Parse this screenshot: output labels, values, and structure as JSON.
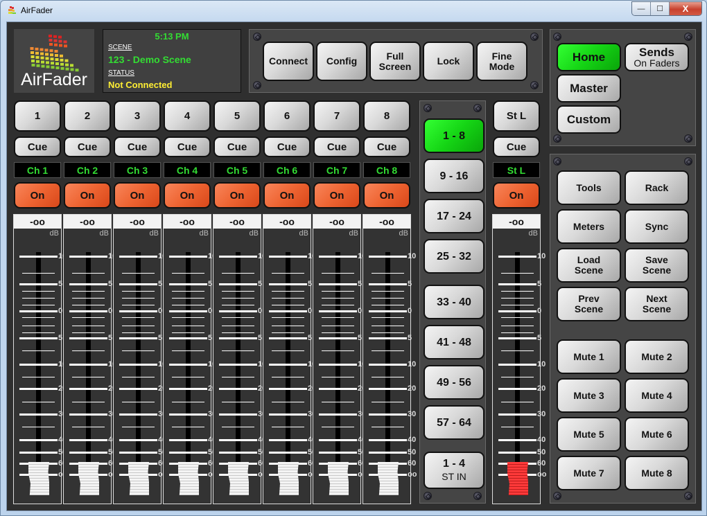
{
  "window": {
    "title": "AirFader",
    "controls": {
      "minimize": "—",
      "maximize": "☐",
      "close": "X"
    }
  },
  "logo": {
    "text": "AirFader"
  },
  "info": {
    "time": "5:13 PM",
    "scene_label": "SCENE",
    "scene_value": "123 - Demo Scene",
    "status_label": "STATUS",
    "status_value": "Not Connected",
    "scene_color": "#33dd33",
    "status_color": "#ffee33"
  },
  "toolbar": {
    "buttons": [
      {
        "label": "Connect"
      },
      {
        "label": "Config"
      },
      {
        "label": "Full Screen"
      },
      {
        "label": "Lock"
      },
      {
        "label": "Fine Mode"
      }
    ]
  },
  "mode_panel": {
    "home": "Home",
    "sends": "Sends",
    "sends_sub": "On Faders",
    "master": "Master",
    "custom": "Custom"
  },
  "channels": [
    {
      "number": "1",
      "cue": "Cue",
      "name": "Ch 1",
      "on": "On",
      "level": "-oo",
      "unit": "dB"
    },
    {
      "number": "2",
      "cue": "Cue",
      "name": "Ch 2",
      "on": "On",
      "level": "-oo",
      "unit": "dB"
    },
    {
      "number": "3",
      "cue": "Cue",
      "name": "Ch 3",
      "on": "On",
      "level": "-oo",
      "unit": "dB"
    },
    {
      "number": "4",
      "cue": "Cue",
      "name": "Ch 4",
      "on": "On",
      "level": "-oo",
      "unit": "dB"
    },
    {
      "number": "5",
      "cue": "Cue",
      "name": "Ch 5",
      "on": "On",
      "level": "-oo",
      "unit": "dB"
    },
    {
      "number": "6",
      "cue": "Cue",
      "name": "Ch 6",
      "on": "On",
      "level": "-oo",
      "unit": "dB"
    },
    {
      "number": "7",
      "cue": "Cue",
      "name": "Ch 7",
      "on": "On",
      "level": "-oo",
      "unit": "dB"
    },
    {
      "number": "8",
      "cue": "Cue",
      "name": "Ch 8",
      "on": "On",
      "level": "-oo",
      "unit": "dB"
    }
  ],
  "stereo": {
    "number": "St L",
    "cue": "Cue",
    "name": "St L",
    "on": "On",
    "level": "-oo",
    "unit": "dB"
  },
  "fader_scale": {
    "major": [
      "10",
      "5",
      "0",
      "5",
      "10",
      "20",
      "30",
      "40",
      "50",
      "60",
      "oo"
    ]
  },
  "banks": [
    {
      "label": "1 - 8",
      "active": true
    },
    {
      "label": "9 - 16"
    },
    {
      "label": "17 - 24"
    },
    {
      "label": "25 - 32"
    },
    {
      "label": "33 - 40"
    },
    {
      "label": "41 - 48"
    },
    {
      "label": "49 - 56"
    },
    {
      "label": "57 - 64"
    },
    {
      "label": "1 - 4",
      "sub": "ST IN"
    }
  ],
  "tools": [
    {
      "label": "Tools"
    },
    {
      "label": "Rack"
    },
    {
      "label": "Meters"
    },
    {
      "label": "Sync"
    },
    {
      "label": "Load Scene"
    },
    {
      "label": "Save Scene"
    },
    {
      "label": "Prev Scene"
    },
    {
      "label": "Next Scene"
    }
  ],
  "mutes": [
    {
      "label": "Mute 1"
    },
    {
      "label": "Mute 2"
    },
    {
      "label": "Mute 3"
    },
    {
      "label": "Mute 4"
    },
    {
      "label": "Mute 5"
    },
    {
      "label": "Mute 6"
    },
    {
      "label": "Mute 7"
    },
    {
      "label": "Mute 8"
    }
  ],
  "colors": {
    "active_green": "#15d515",
    "on_orange": "#ee6432",
    "label_green": "#33dd33"
  }
}
